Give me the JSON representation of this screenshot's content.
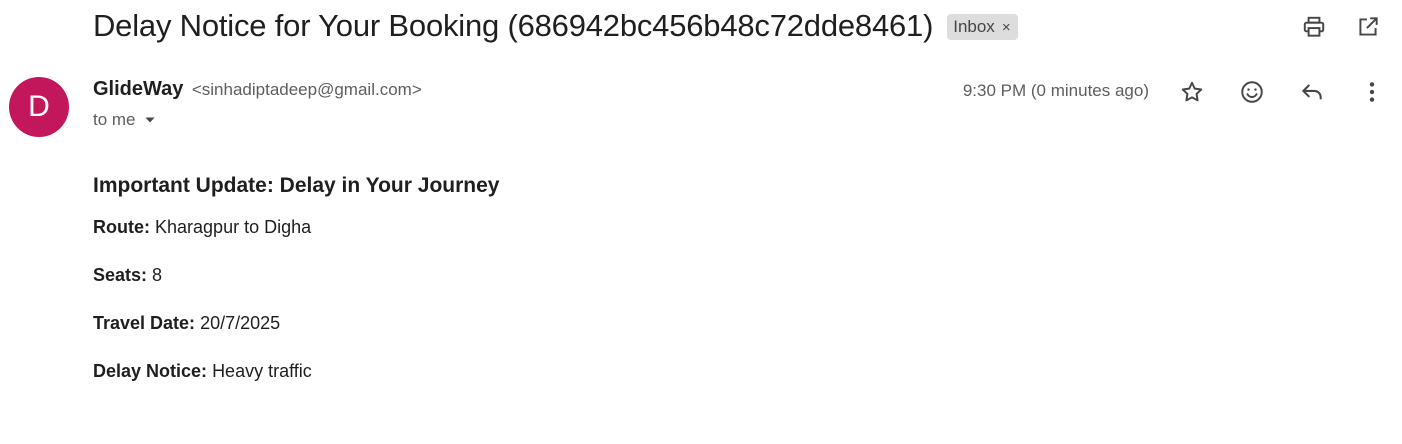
{
  "email": {
    "subject": "Delay Notice for Your Booking (686942bc456b48c72dde8461)",
    "label": "Inbox",
    "label_remove": "×",
    "sender": {
      "initial": "D",
      "avatar_color": "#c2185b",
      "name": "GlideWay",
      "email": "<sinhadiptadeep@gmail.com>",
      "recipient": "to me"
    },
    "timestamp": "9:30 PM (0 minutes ago)"
  },
  "toolbar": {
    "top_icons": [
      "print-icon",
      "open-in-new-window-icon"
    ],
    "message_icons": [
      "star-icon",
      "emoji-reaction-icon",
      "reply-icon",
      "more-vert-icon"
    ]
  },
  "body": {
    "heading": "Important Update: Delay in Your Journey",
    "details": [
      {
        "label": "Route:",
        "value": "Kharagpur to Digha"
      },
      {
        "label": "Seats:",
        "value": "8"
      },
      {
        "label": "Travel Date:",
        "value": "20/7/2025"
      },
      {
        "label": "Delay Notice:",
        "value": "Heavy traffic"
      }
    ]
  }
}
